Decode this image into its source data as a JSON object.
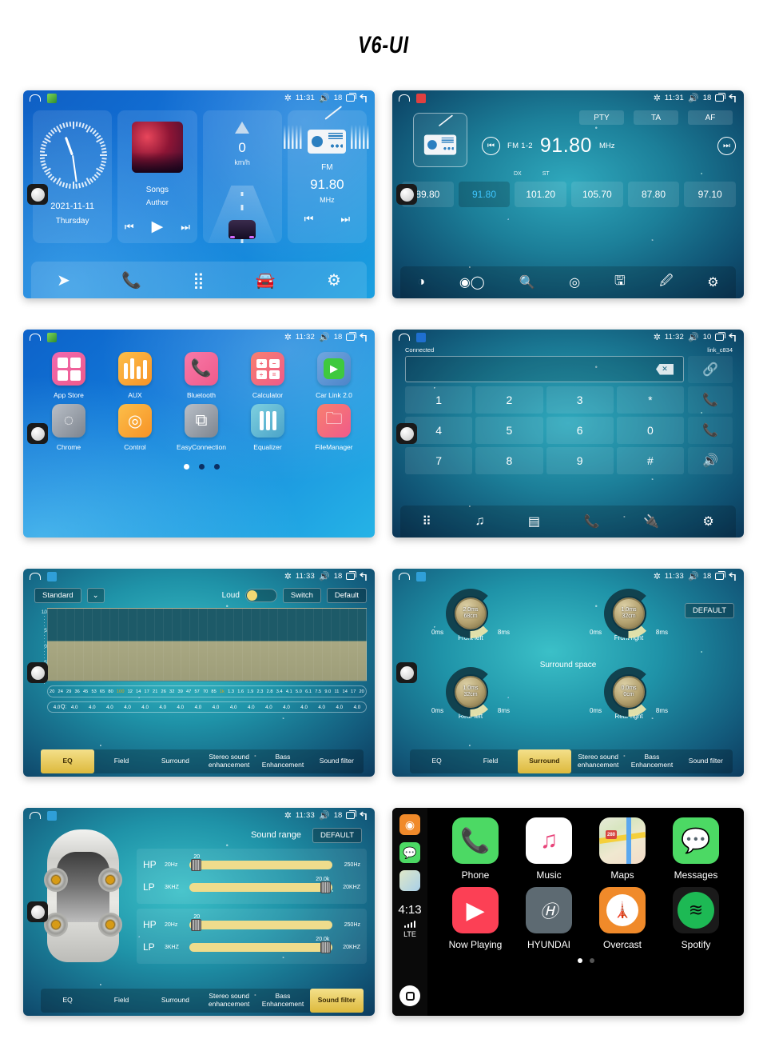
{
  "page": {
    "title": "V6-UI"
  },
  "status_common": {
    "bt_icon": "bluetooth-icon",
    "recents_icon": "recents-icon",
    "back_icon": "back-icon"
  },
  "panels": {
    "home": {
      "status": {
        "time": "11:31",
        "volume": "18"
      },
      "clock": {
        "date": "2021-11-11",
        "day": "Thursday"
      },
      "music": {
        "title": "Songs",
        "author": "Author",
        "prev": "⏮",
        "play": "▶",
        "next": "⏭"
      },
      "speed": {
        "value": "0",
        "unit": "km/h"
      },
      "radio": {
        "band": "FM",
        "freq": "91.80",
        "unit": "MHz",
        "prev": "⏮",
        "next": "⏭"
      },
      "dock": [
        "navigation-icon",
        "phone-icon",
        "apps-icon",
        "carlink-icon",
        "settings-icon"
      ]
    },
    "radio": {
      "status": {
        "time": "11:31",
        "volume": "18"
      },
      "buttons": [
        "PTY",
        "TA",
        "AF"
      ],
      "band": "FM 1-2",
      "freq": "91.80",
      "unit": "MHz",
      "dx": "DX",
      "st": "ST",
      "presets": [
        {
          "freq": "89.80",
          "active": false
        },
        {
          "freq": "91.80",
          "active": true
        },
        {
          "freq": "101.20",
          "active": false
        },
        {
          "freq": "105.70",
          "active": false
        },
        {
          "freq": "87.80",
          "active": false
        },
        {
          "freq": "97.10",
          "active": false
        }
      ],
      "bottom_icons": [
        "band-icon",
        "stereo-mono-icon",
        "search-icon",
        "scan-icon",
        "save-icon",
        "edit-icon",
        "settings-icon"
      ]
    },
    "apps": {
      "status": {
        "time": "11:32",
        "volume": "18"
      },
      "row1": [
        {
          "label": "App Store",
          "icon": "appstore-icon",
          "color1": "#f06ab0",
          "color2": "#ef5a8a"
        },
        {
          "label": "AUX",
          "icon": "aux-icon",
          "color1": "#fcbf4a",
          "color2": "#f79226"
        },
        {
          "label": "Bluetooth",
          "icon": "phone-icon",
          "color1": "#f779a8",
          "color2": "#ef5a8a"
        },
        {
          "label": "Calculator",
          "icon": "calculator-icon",
          "color1": "#f8806f",
          "color2": "#ef5a8a"
        },
        {
          "label": "Car Link 2.0",
          "icon": "carlink-icon",
          "color1": "#6fa7e0",
          "color2": "#4e84c8"
        }
      ],
      "row2": [
        {
          "label": "Chrome",
          "icon": "chrome-icon",
          "color1": "#b9bfc7",
          "color2": "#7d848e"
        },
        {
          "label": "Control",
          "icon": "steering-wheel-icon",
          "color1": "#fcbf4a",
          "color2": "#f79226"
        },
        {
          "label": "EasyConnection",
          "icon": "easyconnection-icon",
          "color1": "#b9bfc7",
          "color2": "#7d848e"
        },
        {
          "label": "Equalizer",
          "icon": "equalizer-icon",
          "color1": "#7ed0e0",
          "color2": "#4aa3c8"
        },
        {
          "label": "FileManager",
          "icon": "folder-icon",
          "color1": "#f8806f",
          "color2": "#ef5a8a"
        }
      ],
      "page_dots": 3,
      "page_active": 1
    },
    "dialer": {
      "status": {
        "time": "11:32",
        "volume": "10"
      },
      "connected_label": "Connected",
      "device_name": "link_c834",
      "input_value": "",
      "backspace_icon": "backspace-icon",
      "keys": [
        "1",
        "2",
        "3",
        "*",
        "4",
        "5",
        "6",
        "0",
        "7",
        "8",
        "9",
        "#"
      ],
      "side_keys": [
        "link-icon",
        "call-icon",
        "hangup-icon",
        "speaker-icon"
      ],
      "bottom_icons": [
        "dialpad-icon",
        "music-icon",
        "contacts-icon",
        "call-log-icon",
        "bluetooth-connect-icon",
        "settings-icon"
      ]
    },
    "eq": {
      "status": {
        "time": "11:33",
        "volume": "18"
      },
      "preset": "Standard",
      "chevron_icon": "chevron-down-icon",
      "loud_label": "Loud",
      "loud_on": true,
      "switch_label": "Switch",
      "default_label": "Default",
      "y_ticks": [
        "10",
        "5",
        "0",
        "-5"
      ],
      "freqs": [
        "20",
        "24",
        "29",
        "36",
        "45",
        "53",
        "65",
        "80",
        "100",
        "12",
        "14",
        "17",
        "21",
        "26",
        "32",
        "39",
        "47",
        "57",
        "70",
        "85",
        "1k",
        "1.3",
        "1.6",
        "1.9",
        "2.3",
        "2.8",
        "3.4",
        "4.1",
        "5.0",
        "6.1",
        "7.5",
        "9.0",
        "11",
        "14",
        "17",
        "20"
      ],
      "freq_highlight": [
        "100",
        "1k"
      ],
      "q_label": "Q:",
      "q_values": [
        "4.0",
        "4.0",
        "4.0",
        "4.0",
        "4.0",
        "4.0",
        "4.0",
        "4.0",
        "4.0",
        "4.0",
        "4.0",
        "4.0",
        "4.0",
        "4.0",
        "4.0",
        "4.0",
        "4.0",
        "4.0"
      ],
      "tabs": [
        "EQ",
        "Field",
        "Surround",
        "Stereo sound enhancement",
        "Bass Enhancement",
        "Sound filter"
      ],
      "active_tab": "EQ"
    },
    "surround": {
      "status": {
        "time": "11:33",
        "volume": "18"
      },
      "default_label": "DEFAULT",
      "center_label": "Surround space",
      "knobs": [
        {
          "name": "Front left",
          "delay": "2.0ms",
          "distance": "68cm",
          "min": "0ms",
          "max": "8ms"
        },
        {
          "name": "Front right",
          "delay": "1.0ms",
          "distance": "32cm",
          "min": "0ms",
          "max": "8ms"
        },
        {
          "name": "Rear left",
          "delay": "1.0ms",
          "distance": "32cm",
          "min": "0ms",
          "max": "8ms"
        },
        {
          "name": "Rear right",
          "delay": "0.0ms",
          "distance": "0cm",
          "min": "0ms",
          "max": "8ms"
        }
      ],
      "tabs": [
        "EQ",
        "Field",
        "Surround",
        "Stereo sound enhancement",
        "Bass Enhancement",
        "Sound filter"
      ],
      "active_tab": "Surround"
    },
    "soundfilter": {
      "status": {
        "time": "11:33",
        "volume": "18"
      },
      "title": "Sound range",
      "default_label": "DEFAULT",
      "groups": [
        {
          "rows": [
            {
              "name": "HP",
              "min": "20Hz",
              "max": "250Hz",
              "value": "20",
              "pos": 3
            },
            {
              "name": "LP",
              "min": "3KHZ",
              "max": "20KHZ",
              "value": "20.0k",
              "pos": 95
            }
          ]
        },
        {
          "rows": [
            {
              "name": "HP",
              "min": "20Hz",
              "max": "250Hz",
              "value": "20",
              "pos": 3
            },
            {
              "name": "LP",
              "min": "3KHZ",
              "max": "20KHZ",
              "value": "20.0k",
              "pos": 95
            }
          ]
        }
      ],
      "tabs": [
        "EQ",
        "Field",
        "Surround",
        "Stereo sound enhancement",
        "Bass Enhancement",
        "Sound filter"
      ],
      "active_tab": "Sound filter"
    },
    "carplay": {
      "sidebar": {
        "minis": [
          "overcast-icon",
          "messages-icon",
          "maps-icon"
        ],
        "time": "4:13",
        "signal": "signal-bars-icon",
        "network": "LTE",
        "home": "home-icon"
      },
      "row1": [
        {
          "label": "Phone",
          "icon": "phone-icon"
        },
        {
          "label": "Music",
          "icon": "music-icon"
        },
        {
          "label": "Maps",
          "icon": "maps-icon"
        },
        {
          "label": "Messages",
          "icon": "messages-icon"
        }
      ],
      "row2": [
        {
          "label": "Now Playing",
          "icon": "now-playing-icon"
        },
        {
          "label": "HYUNDAI",
          "icon": "hyundai-icon"
        },
        {
          "label": "Overcast",
          "icon": "overcast-icon"
        },
        {
          "label": "Spotify",
          "icon": "spotify-icon"
        }
      ],
      "page_dots": 2,
      "page_active": 1
    }
  }
}
